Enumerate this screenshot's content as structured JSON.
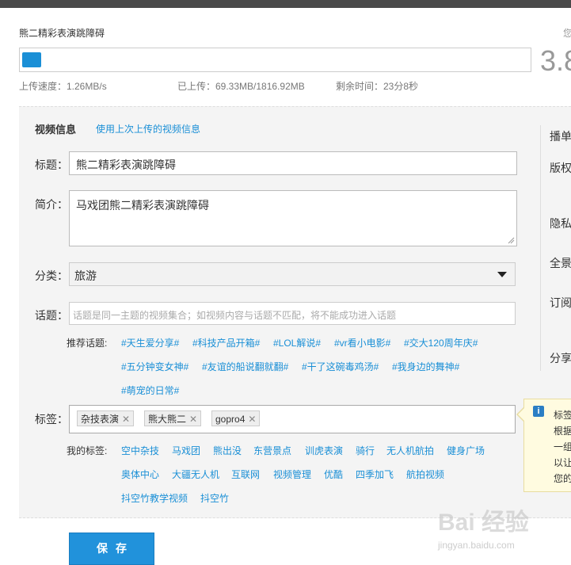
{
  "upload": {
    "filename": "熊二精彩表演跳障碍",
    "corner_text": "您",
    "progress_fraction": 0.038,
    "percent_text": "3.8",
    "speed": "上传速度：1.26MB/s",
    "uploaded": "已上传：69.33MB/1816.92MB",
    "remaining": "剩余时间：23分8秒"
  },
  "form": {
    "section_title": "视频信息",
    "use_last_link": "使用上次上传的视频信息",
    "title_label": "标题：",
    "title_value": "熊二精彩表演跳障碍",
    "intro_label": "简介：",
    "intro_value": "马戏团熊二精彩表演跳障碍",
    "category_label": "分类：",
    "category_value": "旅游",
    "topic_label": "话题：",
    "topic_placeholder": "话题是同一主题的视频集合；如视频内容与话题不匹配，将不能成功进入话题",
    "recommended_label": "推荐话题:",
    "recommended_topics": [
      "#天生爱分享#",
      "#科技产品开箱#",
      "#LOL解说#",
      "#vr看小电影#",
      "#交大120周年庆#",
      "#五分钟变女神#",
      "#友谊的船说翻就翻#",
      "#干了这碗毒鸡汤#",
      "#我身边的舞神#",
      "#萌宠的日常#"
    ],
    "tags_label": "标签：",
    "tags": [
      "杂技表演",
      "熊大熊二",
      "gopro4"
    ],
    "my_tags_label": "我的标签:",
    "my_tags": [
      "空中杂技",
      "马戏团",
      "熊出没",
      "东营景点",
      "训虎表演",
      "骑行",
      "无人机航拍",
      "健身广场",
      "奥体中心",
      "大疆无人机",
      "互联网",
      "视频管理",
      "优酷",
      "四季加飞",
      "航拍视频",
      "抖空竹教学视频",
      "抖空竹"
    ],
    "save_label": "保存"
  },
  "right_panel": {
    "labels": [
      "播单",
      "版权",
      "隐私",
      "全景",
      "订阅",
      "分享"
    ]
  },
  "tip": {
    "icon": "info-icon",
    "lines": [
      "标签",
      "根据",
      "一组",
      "以让",
      "您的"
    ]
  },
  "watermark": {
    "text": "Bai 经验",
    "url": "jingyan.baidu.com"
  }
}
